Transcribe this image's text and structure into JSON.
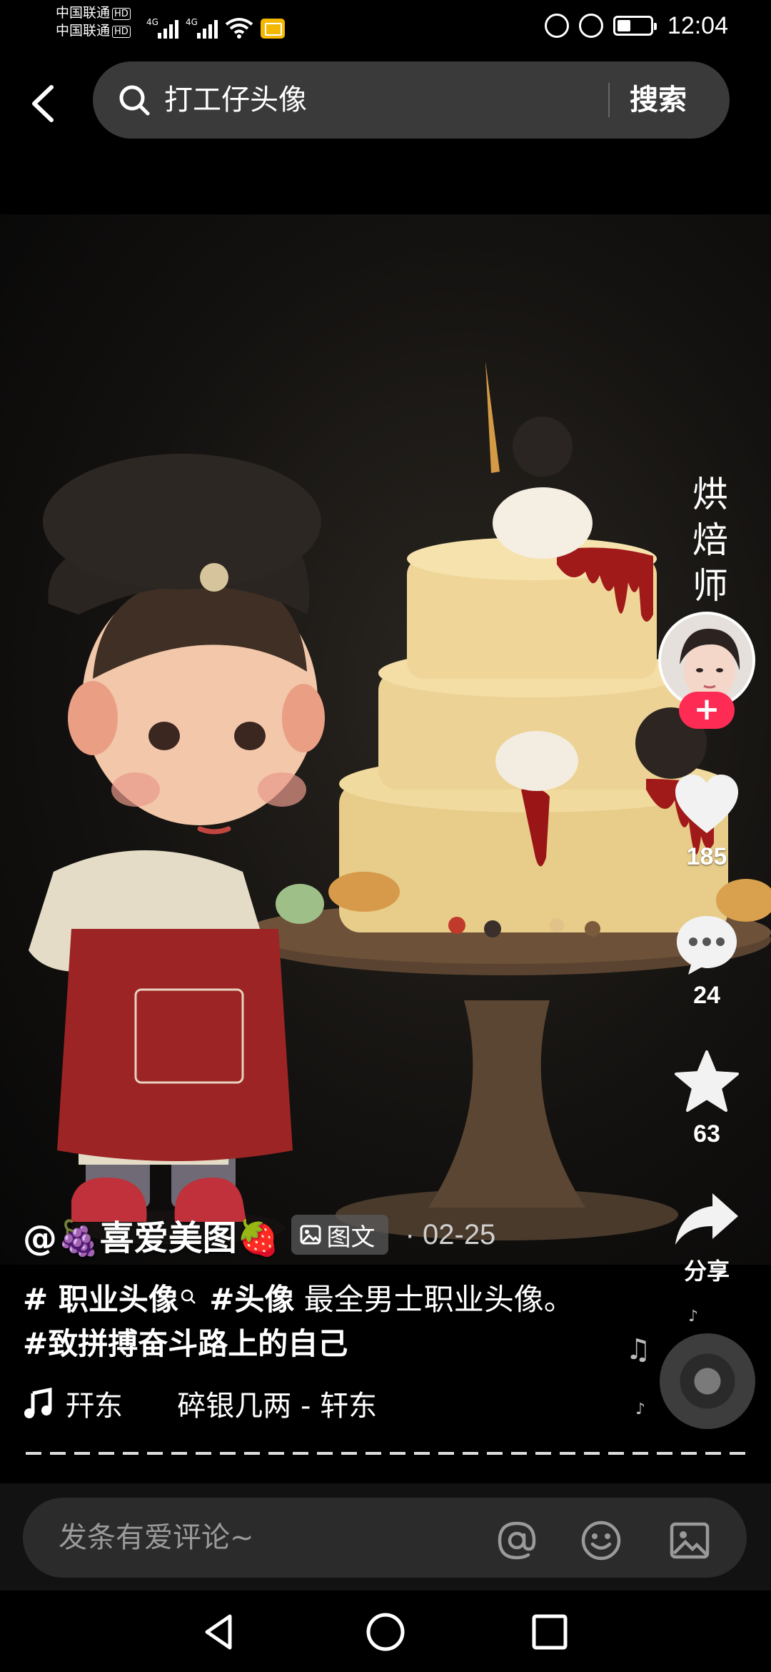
{
  "status_bar": {
    "carrier_1": "中国联通",
    "carrier_2": "中国联通",
    "hd_badge": "HD",
    "network_1": "4G",
    "network_2": "4G",
    "time": "12:04"
  },
  "search": {
    "query": "打工仔头像",
    "button_label": "搜索"
  },
  "post": {
    "vertical_title": "烘焙师",
    "author": "@🍇喜爱美图🍓",
    "type_badge": "图文",
    "date_separator": "·",
    "date": "02-25",
    "caption": {
      "tag_1": "# 职业头像",
      "tag_2": "#头像",
      "text": "最全男士职业头像。",
      "tag_3": "#致拼搏奋斗路上的自己"
    },
    "music": "幵东      碎银几两 - 轩东"
  },
  "actions": {
    "likes": "185",
    "comments": "24",
    "favorites": "63",
    "share_label": "分享"
  },
  "comment_bar": {
    "placeholder": "发条有爱评论~"
  },
  "colors": {
    "follow_accent": "#fe2c55",
    "search_bg": "#3a3a3a"
  },
  "icons": [
    "back-arrow-icon",
    "search-icon",
    "heart-icon",
    "comment-icon",
    "star-icon",
    "share-icon",
    "music-note-icon",
    "at-icon",
    "emoji-icon",
    "image-icon"
  ]
}
